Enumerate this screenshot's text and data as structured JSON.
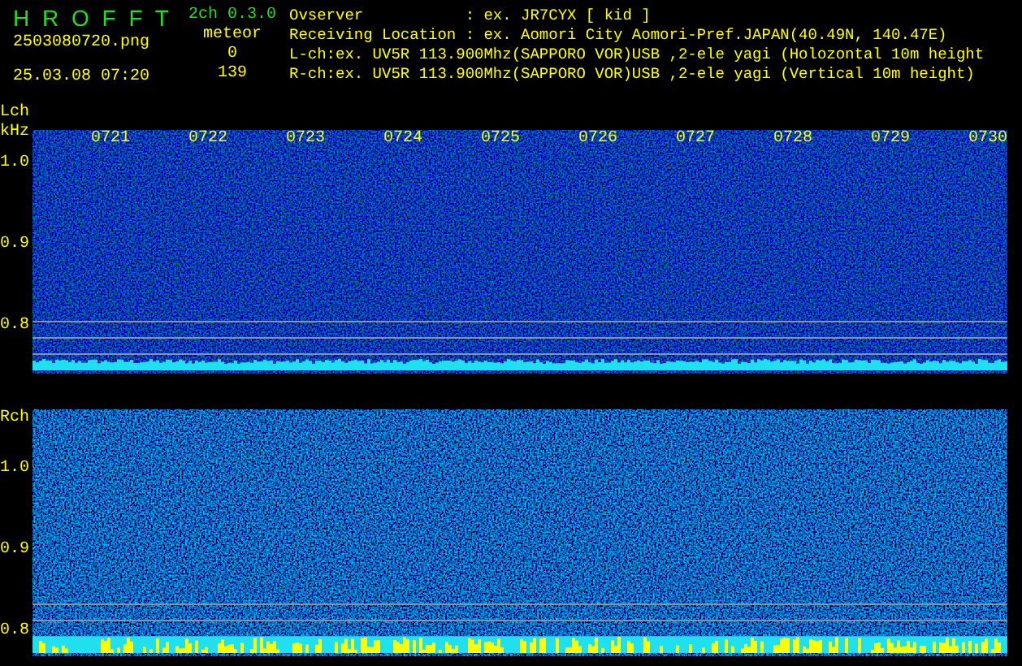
{
  "app": {
    "title": "H R O F F T",
    "version": "2ch 0.3.0",
    "file": "2503080720.png",
    "datetime": "25.03.08 07:20",
    "mode": "meteor",
    "counts": [
      "0",
      "139"
    ]
  },
  "info": [
    {
      "kind": "field",
      "label": "Ovserver",
      "value": ": ex. JR7CYX [ kid ]"
    },
    {
      "kind": "field",
      "label": "Receiving Location",
      "value": ": ex. Aomori City Aomori-Pref.JAPAN(40.49N, 140.47E)"
    },
    {
      "kind": "line",
      "value": "L-ch:ex. UV5R 113.900Mhz(SAPPORO VOR)USB ,2-ele yagi (Holozontal 10m height"
    },
    {
      "kind": "line",
      "value": "R-ch:ex. UV5R 113.900Mhz(SAPPORO VOR)USB ,2-ele yagi (Vertical 10m height)"
    }
  ],
  "panels": [
    {
      "name": "Lch",
      "unit": "kHz",
      "y_labels": [
        "1.0",
        "0.9",
        "0.8"
      ],
      "time_labels": [
        "0721",
        "0722",
        "0723",
        "0724",
        "0725",
        "0726",
        "0727",
        "0728",
        "0729",
        "0730"
      ]
    },
    {
      "name": "Rch",
      "y_labels": [
        "1.0",
        "0.9",
        "0.8"
      ]
    }
  ]
}
